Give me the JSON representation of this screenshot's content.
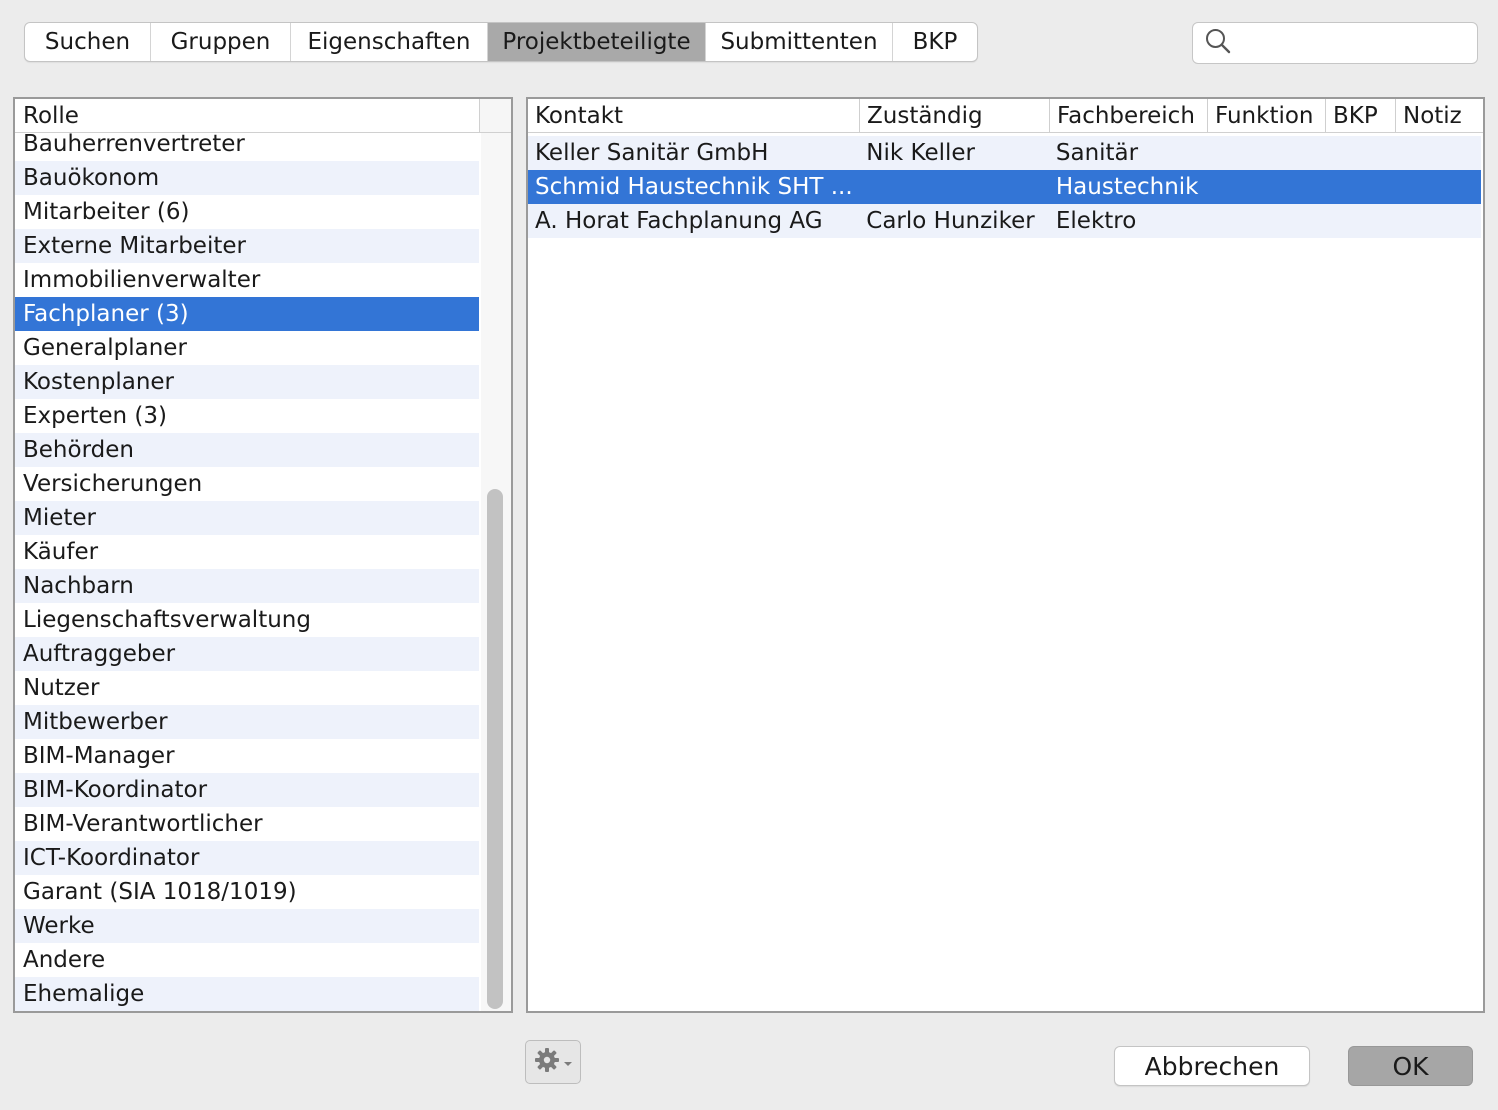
{
  "tabs": [
    {
      "label": "Suchen",
      "active": false
    },
    {
      "label": "Gruppen",
      "active": false
    },
    {
      "label": "Eigenschaften",
      "active": false
    },
    {
      "label": "Projektbeteiligte",
      "active": true
    },
    {
      "label": "Submittenten",
      "active": false
    },
    {
      "label": "BKP",
      "active": false
    }
  ],
  "search": {
    "value": "",
    "placeholder": ""
  },
  "roles": {
    "header": "Rolle",
    "items": [
      "Bauherrenvertreter",
      "Bauökonom",
      "Mitarbeiter (6)",
      "Externe Mitarbeiter",
      "Immobilienverwalter",
      "Fachplaner (3)",
      "Generalplaner",
      "Kostenplaner",
      "Experten (3)",
      "Behörden",
      "Versicherungen",
      "Mieter",
      "Käufer",
      "Nachbarn",
      "Liegenschaftsverwaltung",
      "Auftraggeber",
      "Nutzer",
      "Mitbewerber",
      "BIM-Manager",
      "BIM-Koordinator",
      "BIM-Verantwortlicher",
      "ICT-Koordinator",
      "Garant (SIA 1018/1019)",
      "Werke",
      "Andere",
      "Ehemalige"
    ],
    "selected_index": 5
  },
  "contacts": {
    "columns": [
      "Kontakt",
      "Zuständig",
      "Fachbereich",
      "Funktion",
      "BKP",
      "Notiz"
    ],
    "rows": [
      [
        "Keller Sanitär GmbH",
        "Nik Keller",
        "Sanitär",
        "",
        "",
        ""
      ],
      [
        "Schmid Haustechnik SHT ...",
        "",
        "Haustechnik",
        "",
        "",
        ""
      ],
      [
        "A. Horat Fachplanung AG",
        "Carlo Hunziker",
        "Elektro",
        "",
        "",
        ""
      ]
    ],
    "selected_index": 1
  },
  "icons": {
    "search": "search-icon",
    "gear": "gear-icon",
    "dropdown": "chevron-down-icon"
  },
  "buttons": {
    "cancel": "Abbrechen",
    "ok": "OK"
  },
  "colors": {
    "selection": "#3375d6",
    "alt_row": "#eef2fb",
    "active_tab": "#a9a9a9",
    "default_button": "#a6a6a6"
  }
}
